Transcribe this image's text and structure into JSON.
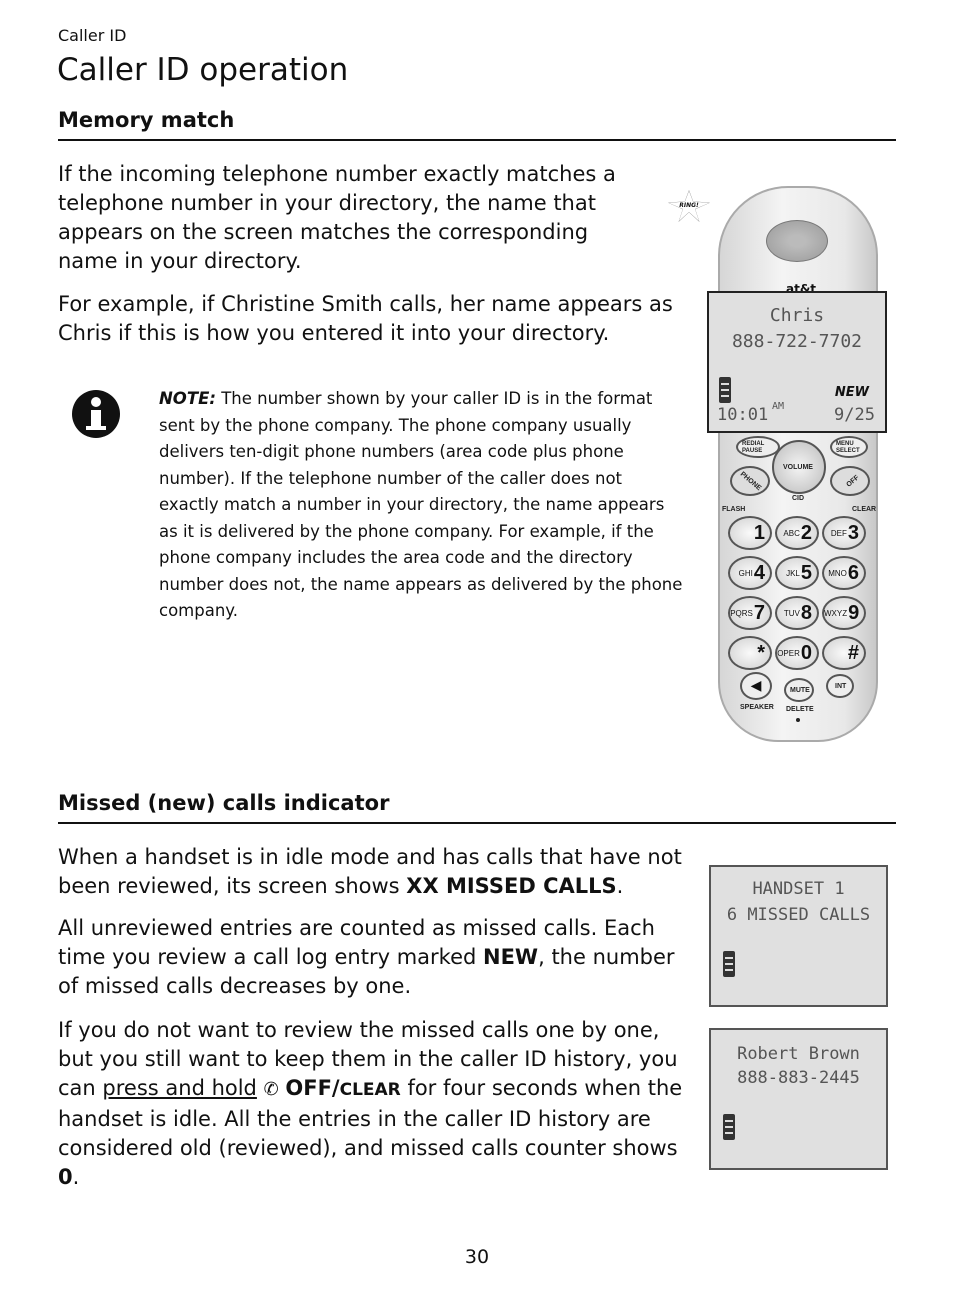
{
  "section_label": "Caller ID",
  "title": "Caller ID operation",
  "memory_match": {
    "heading": "Memory match",
    "p1": "If the incoming telephone number exactly matches a telephone number in your directory, the name that appears on the screen matches the corresponding name in your directory.",
    "p2": "For example, if Christine Smith calls, her name appears as Chris if this is how you entered it into your directory.",
    "note_label": "NOTE:",
    "note_text": " The number shown by your caller ID is in the format sent by the phone company. The phone company usually delivers ten-digit phone numbers (area code plus phone number). If the telephone number of the caller does not exactly match a number in your directory, the name appears as it is delivered by the phone company. For example, if the phone company includes the area code and the directory number does not, the name appears as delivered by the phone company.",
    "note_icon": "info-icon"
  },
  "phone": {
    "ring": "RING!",
    "brand": "at&t",
    "screen": {
      "name": "Chris",
      "number": "888-722-7702",
      "new": "NEW",
      "time": "10:01",
      "ampm": "AM",
      "date": "9/25"
    },
    "buttons": {
      "redial": "REDIAL PAUSE",
      "menu": "MENU SELECT",
      "volume": "VOLUME",
      "cid": "CID",
      "phone": "PHONE",
      "off": "OFF",
      "flash": "FLASH",
      "clear": "CLEAR",
      "speaker": "SPEAKER",
      "mute": "MUTE",
      "delete": "DELETE",
      "int": "INT"
    },
    "keys": [
      [
        "",
        "1"
      ],
      [
        "ABC",
        "2"
      ],
      [
        "DEF",
        "3"
      ],
      [
        "GHI",
        "4"
      ],
      [
        "JKL",
        "5"
      ],
      [
        "MNO",
        "6"
      ],
      [
        "PQRS",
        "7"
      ],
      [
        "TUV",
        "8"
      ],
      [
        "WXYZ",
        "9"
      ],
      [
        "",
        "*"
      ],
      [
        "OPER",
        "0"
      ],
      [
        "",
        "#"
      ]
    ]
  },
  "missed": {
    "heading": "Missed (new) calls indicator",
    "p1a": "When a handset is in idle mode and has calls that have not been reviewed, its screen shows ",
    "p1b": "XX MISSED CALLS",
    "p1c": ".",
    "p2a": "All unreviewed entries are counted as missed calls. Each time you review a call log entry marked ",
    "p2b": "NEW",
    "p2c": ", the number of missed calls decreases by one.",
    "p3a": "If you do not want to review the missed calls one by one, but you still want to keep them in the caller ID history, you can ",
    "p3link": "press and hold",
    "p3key1": "OFF/",
    "p3key2": "CLEAR",
    "p3b": " for four seconds when the handset is idle. All the entries in the caller ID history are considered old (reviewed), and missed calls counter shows ",
    "p3c": "0",
    "p3d": ".",
    "screen1": {
      "line1": "HANDSET 1",
      "line2": "6 MISSED CALLS"
    },
    "screen2": {
      "line1": "Robert Brown",
      "line2": "888-883-2445"
    }
  },
  "page_number": "30"
}
